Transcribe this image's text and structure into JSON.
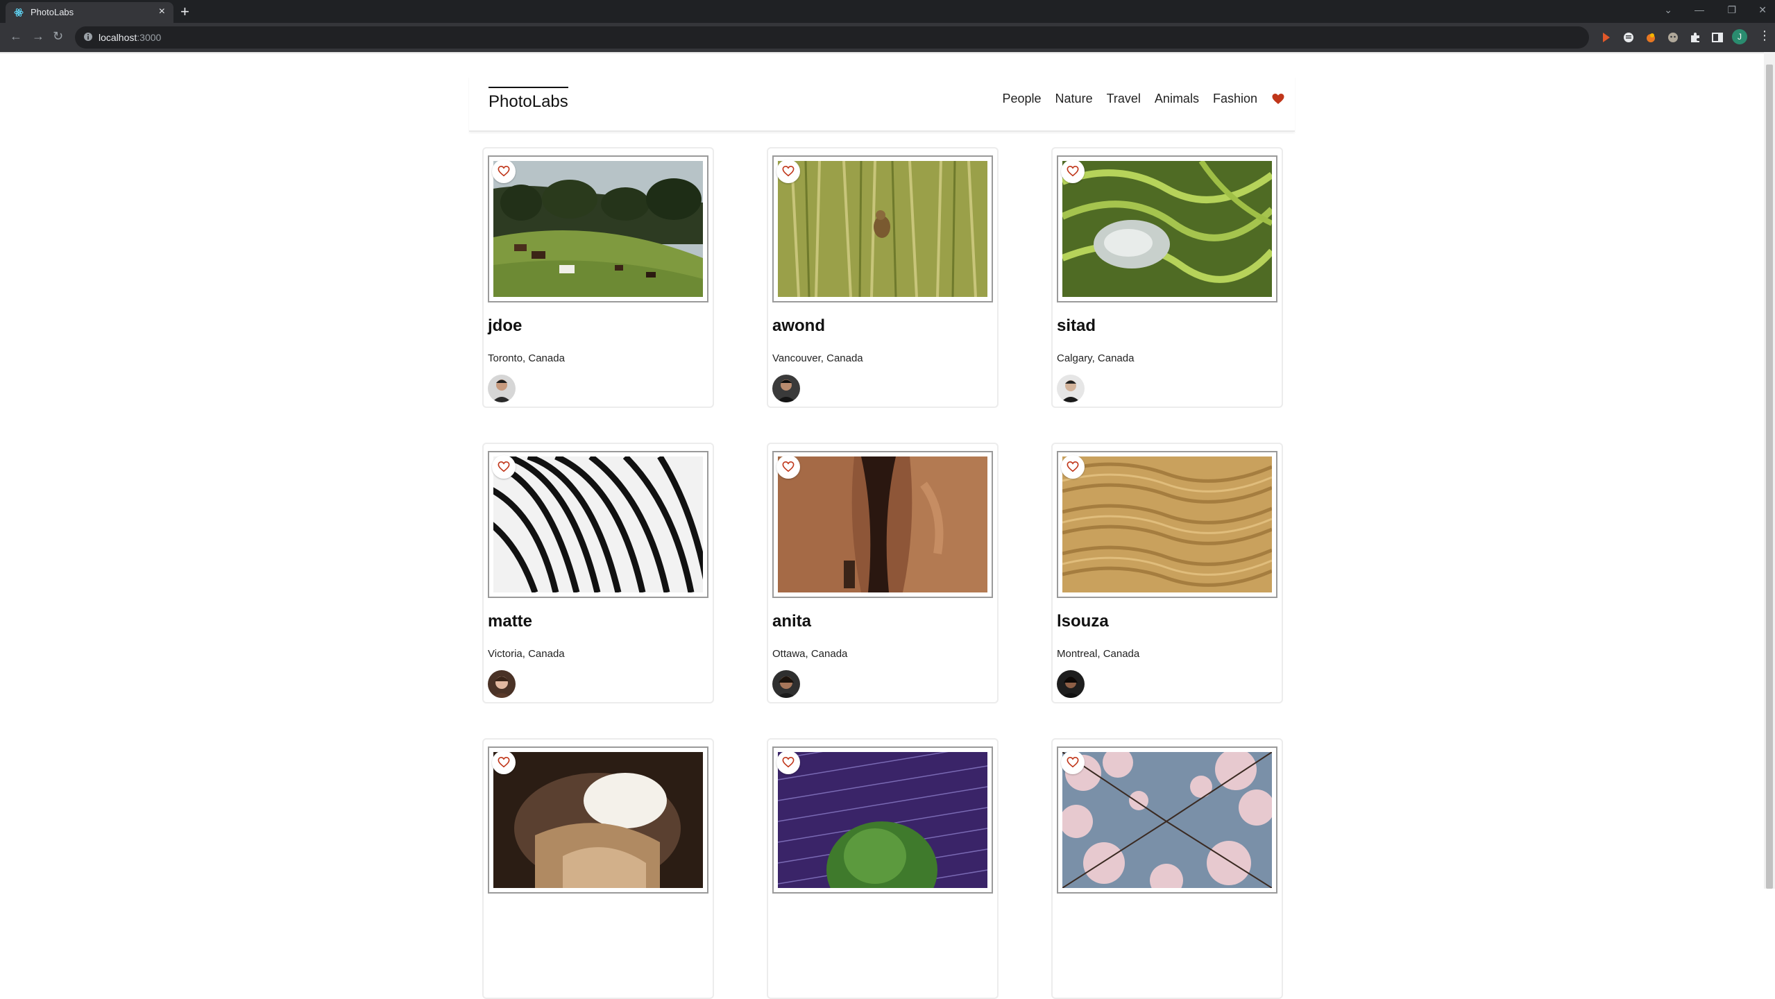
{
  "browser": {
    "tab_title": "PhotoLabs",
    "url_host": "localhost",
    "url_port": ":3000",
    "profile_initial": "J"
  },
  "app": {
    "logo": "PhotoLabs",
    "topics": [
      "People",
      "Nature",
      "Travel",
      "Animals",
      "Fashion"
    ],
    "fav_badge_icon": "heart-icon",
    "accent_color": "#c0361a"
  },
  "photos": [
    {
      "username": "jdoe",
      "location": "Toronto, Canada",
      "scene": "horses grazing on hill"
    },
    {
      "username": "awond",
      "location": "Vancouver, Canada",
      "scene": "bird in reeds"
    },
    {
      "username": "sitad",
      "location": "Calgary, Canada",
      "scene": "rice terraces"
    },
    {
      "username": "matte",
      "location": "Victoria, Canada",
      "scene": "zebra stripes"
    },
    {
      "username": "anita",
      "location": "Ottawa, Canada",
      "scene": "sandstone canyon"
    },
    {
      "username": "lsouza",
      "location": "Montreal, Canada",
      "scene": "sand dunes"
    },
    {
      "username": "",
      "location": "",
      "scene": "cave opening"
    },
    {
      "username": "",
      "location": "",
      "scene": "tree under star trails"
    },
    {
      "username": "",
      "location": "",
      "scene": "cherry blossoms"
    }
  ]
}
